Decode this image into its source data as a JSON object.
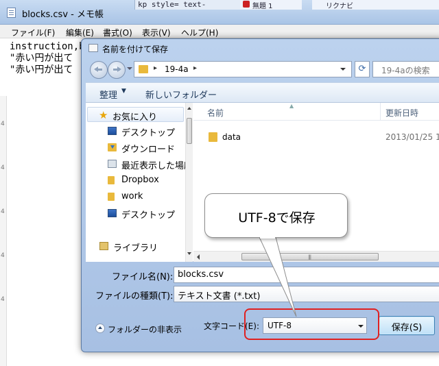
{
  "notepad": {
    "title": "blocks.csv - メモ帳",
    "menu": [
      "ファイル(F)",
      "編集(E)",
      "書式(O)",
      "表示(V)",
      "ヘルプ(H)"
    ],
    "text_lines": [
      "instruction,b",
      "\"赤い円が出て",
      "\"赤い円が出て"
    ],
    "side_marks": [
      "4",
      "4",
      "4",
      "4",
      "4"
    ]
  },
  "background": {
    "fragment_code": "kp style= text-",
    "fragment_tab": "無題 1",
    "fragment_right": "リクナビ"
  },
  "dialog": {
    "title": "名前を付けて保存",
    "address": {
      "path": "19-4a",
      "separator": "▸"
    },
    "search_placeholder": "19-4aの検索",
    "toolbar": {
      "organize": "整理",
      "organize_arrow": "▼",
      "new_folder": "新しいフォルダー"
    },
    "nav_items": [
      {
        "label": "お気に入り",
        "icon": "star-icon"
      },
      {
        "label": "デスクトップ",
        "icon": "desktop-icon"
      },
      {
        "label": "ダウンロード",
        "icon": "downloads-icon"
      },
      {
        "label": "最近表示した場所",
        "icon": "recent-places-icon"
      },
      {
        "label": "Dropbox",
        "icon": "folder-icon"
      },
      {
        "label": "work",
        "icon": "folder-icon"
      },
      {
        "label": "デスクトップ",
        "icon": "desktop-icon"
      },
      {
        "label": "ライブラリ",
        "icon": "library-icon"
      }
    ],
    "columns": {
      "name": "名前",
      "date": "更新日時"
    },
    "files": [
      {
        "name": "data",
        "date": "2013/01/25 1"
      }
    ],
    "hscroll_grip": "|||",
    "form": {
      "filename_label": "ファイル名(N):",
      "filename_value": "blocks.csv",
      "filetype_label": "ファイルの種類(T):",
      "filetype_value": "テキスト文書 (*.txt)",
      "hide_folders": "フォルダーの非表示",
      "encoding_label": "文字コード(E):",
      "encoding_value": "UTF-8",
      "save_button": "保存(S)"
    }
  },
  "annotation": {
    "callout_text": "UTF-8で保存",
    "highlight_color": "#e02020"
  }
}
